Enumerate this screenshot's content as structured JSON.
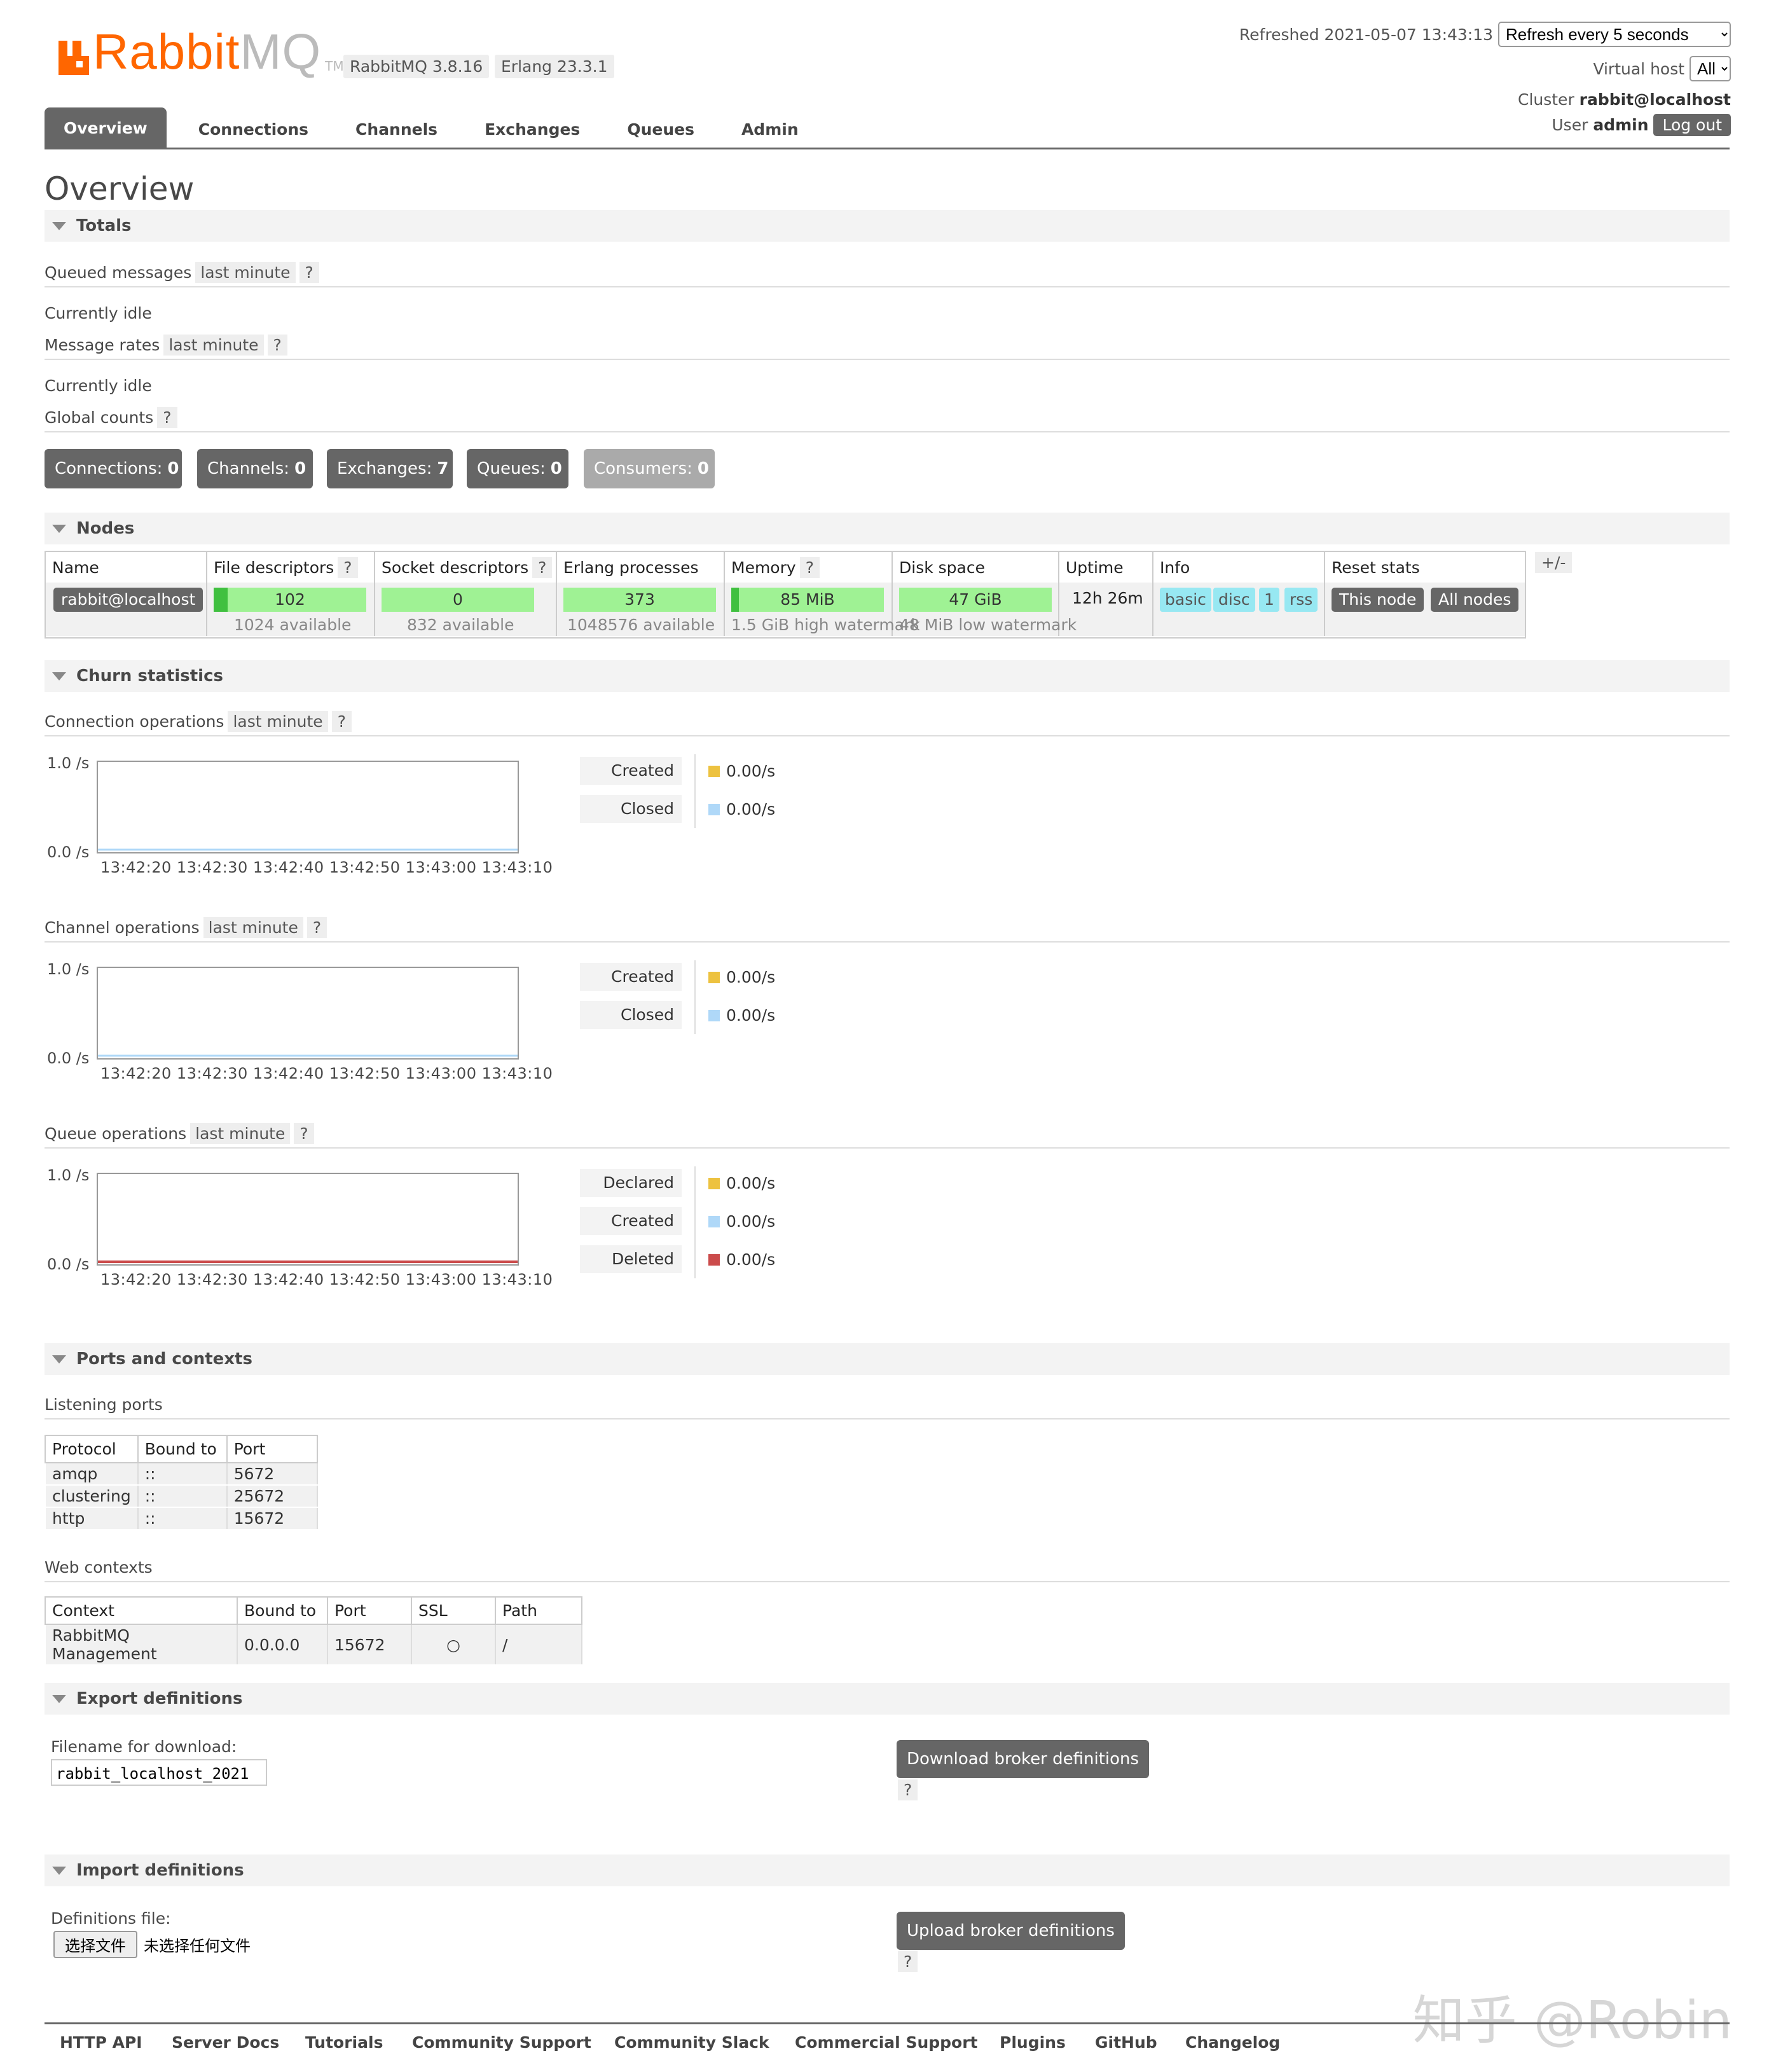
{
  "header": {
    "logo_text_main": "Rabbit",
    "logo_text_mq": "MQ",
    "logo_tm": "TM",
    "rabbitmq_version": "RabbitMQ 3.8.16",
    "erlang_version": "Erlang 23.3.1",
    "refreshed_label": "Refreshed 2021-05-07 13:43:13",
    "refresh_option": "Refresh every 5 seconds",
    "virtual_host_label": "Virtual host",
    "virtual_host_value": "All",
    "cluster_label": "Cluster",
    "cluster_value": "rabbit@localhost",
    "user_label": "User",
    "user_value": "admin",
    "logout_label": "Log out",
    "accent_color": "#ff6600"
  },
  "tabs": [
    {
      "label": "Overview",
      "active": true
    },
    {
      "label": "Connections"
    },
    {
      "label": "Channels"
    },
    {
      "label": "Exchanges"
    },
    {
      "label": "Queues"
    },
    {
      "label": "Admin"
    }
  ],
  "page_title": "Overview",
  "totals": {
    "title": "Totals",
    "queued_messages_label": "Queued messages",
    "last_minute": "last minute",
    "help": "?",
    "currently_idle": "Currently idle",
    "message_rates_label": "Message rates",
    "global_counts_label": "Global counts",
    "counts": [
      {
        "label": "Connections:",
        "value": "0"
      },
      {
        "label": "Channels:",
        "value": "0"
      },
      {
        "label": "Exchanges:",
        "value": "7"
      },
      {
        "label": "Queues:",
        "value": "0"
      },
      {
        "label": "Consumers:",
        "value": "0"
      }
    ]
  },
  "nodes": {
    "title": "Nodes",
    "plus_minus": "+/-",
    "columns": [
      "Name",
      "File descriptors",
      "Socket descriptors",
      "Erlang processes",
      "Memory",
      "Disk space",
      "Uptime",
      "Info",
      "Reset stats"
    ],
    "row": {
      "name": "rabbit@localhost",
      "file_descriptors": "102",
      "file_descriptors_sub": "1024 available",
      "socket_descriptors": "0",
      "socket_descriptors_sub": "832 available",
      "erlang_processes": "373",
      "erlang_processes_sub": "1048576 available",
      "memory": "85 MiB",
      "memory_sub": "1.5 GiB high watermark",
      "disk_space": "47 GiB",
      "disk_space_sub": "48 MiB low watermark",
      "uptime": "12h 26m",
      "info_tags": [
        "basic",
        "disc",
        "1",
        "rss"
      ],
      "reset_this_node": "This node",
      "reset_all_nodes": "All nodes"
    }
  },
  "churn": {
    "title": "Churn statistics",
    "y_max": "1.0 /s",
    "y_min": "0.0 /s",
    "x_ticks": "13:42:20 13:42:30 13:42:40 13:42:50 13:43:00 13:43:10",
    "connection": {
      "label": "Connection operations",
      "legend": [
        {
          "name": "Created",
          "value": "0.00/s",
          "color": "#edc240"
        },
        {
          "name": "Closed",
          "value": "0.00/s",
          "color": "#afd8f8"
        }
      ]
    },
    "channel": {
      "label": "Channel operations",
      "legend": [
        {
          "name": "Created",
          "value": "0.00/s",
          "color": "#edc240"
        },
        {
          "name": "Closed",
          "value": "0.00/s",
          "color": "#afd8f8"
        }
      ]
    },
    "queue": {
      "label": "Queue operations",
      "legend": [
        {
          "name": "Declared",
          "value": "0.00/s",
          "color": "#edc240"
        },
        {
          "name": "Created",
          "value": "0.00/s",
          "color": "#afd8f8"
        },
        {
          "name": "Deleted",
          "value": "0.00/s",
          "color": "#cb4b4b"
        }
      ]
    }
  },
  "ports": {
    "title": "Ports and contexts",
    "listening_label": "Listening ports",
    "listening_columns": [
      "Protocol",
      "Bound to",
      "Port"
    ],
    "listening_rows": [
      [
        "amqp",
        "::",
        "5672"
      ],
      [
        "clustering",
        "::",
        "25672"
      ],
      [
        "http",
        "::",
        "15672"
      ]
    ],
    "web_label": "Web contexts",
    "web_columns": [
      "Context",
      "Bound to",
      "Port",
      "SSL",
      "Path"
    ],
    "web_rows": [
      [
        "RabbitMQ Management",
        "0.0.0.0",
        "15672",
        "○",
        "/"
      ]
    ]
  },
  "export": {
    "title": "Export definitions",
    "filename_label": "Filename for download:",
    "filename_value": "rabbit_localhost_2021",
    "download_button": "Download broker definitions",
    "help": "?"
  },
  "import": {
    "title": "Import definitions",
    "file_label": "Definitions file:",
    "choose_file": "选择文件",
    "no_file": "未选择任何文件",
    "upload_button": "Upload broker definitions",
    "help": "?"
  },
  "footer": [
    "HTTP API",
    "Server Docs",
    "Tutorials",
    "Community Support",
    "Community Slack",
    "Commercial Support",
    "Plugins",
    "GitHub",
    "Changelog"
  ],
  "watermark": "知乎 @Robin"
}
